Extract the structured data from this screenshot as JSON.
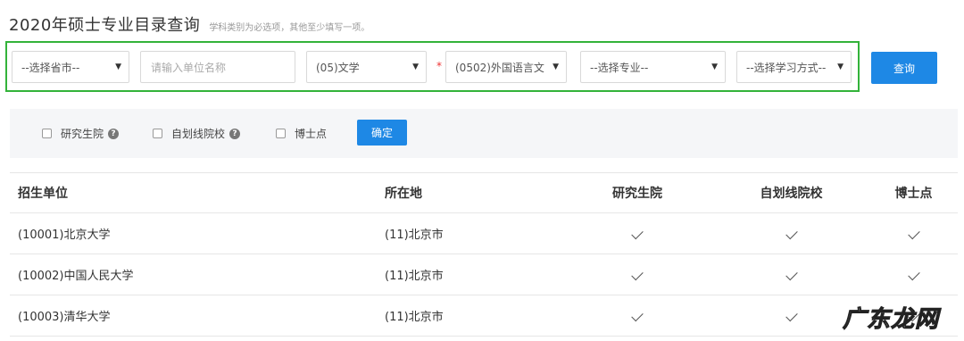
{
  "header": {
    "title": "2020年硕士专业目录查询",
    "hint": "学科类别为必选项，其他至少填写一项。"
  },
  "search": {
    "province": "--选择省市--",
    "unit_placeholder": "请输入单位名称",
    "category": "(05)文学",
    "required_mark": "*",
    "discipline": "(0502)外国语言文",
    "major": "--选择专业--",
    "study_mode": "--选择学习方式--",
    "query_label": "查询"
  },
  "filters": {
    "graduate_school": "研究生院",
    "self_scoring": "自划线院校",
    "doctoral": "博士点",
    "confirm_label": "确定"
  },
  "table": {
    "headers": [
      "招生单位",
      "所在地",
      "研究生院",
      "自划线院校",
      "博士点"
    ],
    "rows": [
      {
        "unit": "(10001)北京大学",
        "location": "(11)北京市",
        "graduate": true,
        "self": true,
        "doctoral": true
      },
      {
        "unit": "(10002)中国人民大学",
        "location": "(11)北京市",
        "graduate": true,
        "self": true,
        "doctoral": true
      },
      {
        "unit": "(10003)清华大学",
        "location": "(11)北京市",
        "graduate": true,
        "self": true,
        "doctoral": true
      }
    ]
  },
  "watermark": "广东龙网"
}
